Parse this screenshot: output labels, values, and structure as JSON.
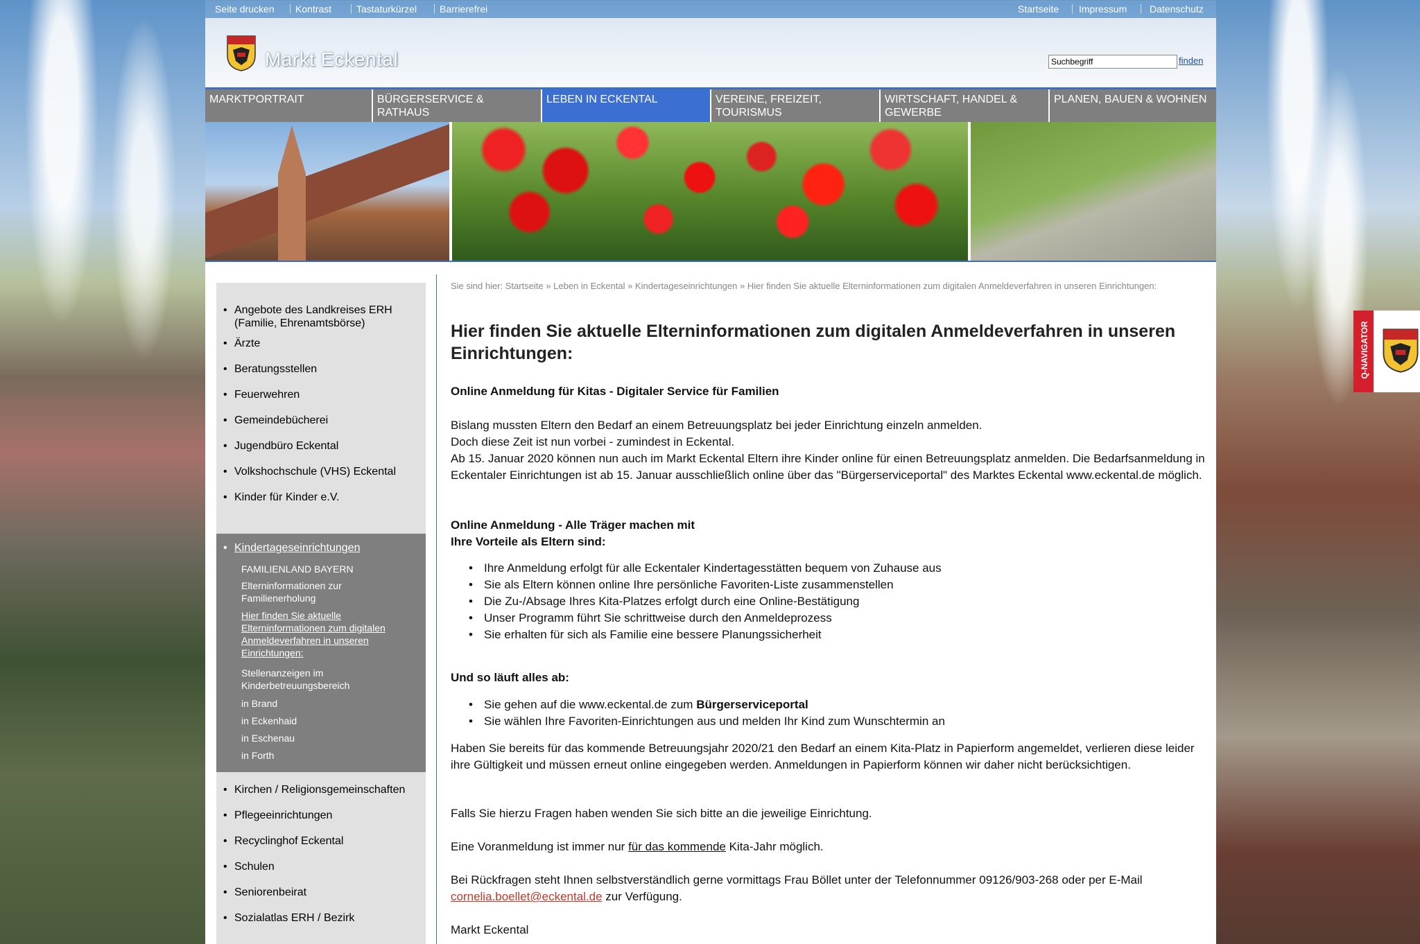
{
  "topbar": {
    "left": [
      "Seite drucken",
      "Kontrast",
      "Tastaturkürzel",
      "Barrierefrei"
    ],
    "right": [
      "Startseite",
      "Impressum",
      "Datenschutz"
    ]
  },
  "header": {
    "site_title": "Markt Eckental",
    "search_placeholder": "Suchbegriff",
    "search_button": "finden"
  },
  "nav": [
    "MARKTPORTRAIT",
    "BÜRGERSERVICE & RATHAUS",
    "LEBEN IN ECKENTAL",
    "VEREINE, FREIZEIT, TOURISMUS",
    "WIRTSCHAFT, HANDEL & GEWERBE",
    "PLANEN, BAUEN & WOHNEN"
  ],
  "sidebar": {
    "items_top": [
      "Angebote des Landkreises ERH (Familie, Ehrenamtsbörse)",
      "Ärzte",
      "Beratungsstellen",
      "Feuerwehren",
      "Gemeindebücherei",
      "Jugendbüro Eckental",
      "Volkshochschule (VHS) Eckental",
      "Kinder für Kinder e.V."
    ],
    "active": "Kindertageseinrichtungen",
    "sub": [
      "FAMILIENLAND BAYERN",
      "Elterninformationen zur Familienerholung",
      "Hier finden Sie aktuelle Elterninformationen zum digitalen Anmeldeverfahren in unseren Einrichtungen:",
      "Stellenanzeigen im Kinderbetreuungsbereich",
      "in Brand",
      "in Eckenhaid",
      "in Eschenau",
      "in Forth"
    ],
    "items_bottom": [
      "Kirchen / Religionsgemeinschaften",
      "Pflegeeinrichtungen",
      "Recyclinghof Eckental",
      "Schulen",
      "Seniorenbeirat",
      "Sozialatlas ERH / Bezirk"
    ]
  },
  "breadcrumb": "Sie sind hier: Startseite » Leben in Eckental » Kindertageseinrichtungen » Hier finden Sie aktuelle Elterninformationen zum digitalen Anmeldeverfahren in unseren Einrichtungen:",
  "main": {
    "title": "Hier finden Sie aktuelle Elterninformationen zum digitalen Anmeldeverfahren in unseren Einrichtungen:",
    "subtitle1": "Online Anmeldung für Kitas - Digitaler Service für Familien",
    "para1": [
      "Bislang mussten Eltern den Bedarf an einem Betreuungsplatz bei jeder Einrichtung einzeln anmelden.",
      "Doch diese Zeit ist nun vorbei - zumindest in Eckental.",
      "Ab 15. Januar 2020 können nun auch im Markt Eckental Eltern ihre Kinder online für einen Betreuungsplatz anmelden. Die Bedarfsanmeldung in Eckentaler Einrichtungen ist ab 15. Januar ausschließlich online über das \"Bürgerserviceportal\" des Marktes Eckental www.eckental.de möglich."
    ],
    "subtitle2a": "Online Anmeldung - Alle Träger machen mit",
    "subtitle2b": "Ihre Vorteile als Eltern sind:",
    "advantages": [
      "Ihre Anmeldung erfolgt für alle Eckentaler Kindertagesstätten bequem von Zuhause aus",
      "Sie als Eltern können online Ihre persönliche Favoriten-Liste zusammenstellen",
      "Die Zu-/Absage Ihres Kita-Platzes erfolgt durch eine Online-Bestätigung",
      "Unser Programm führt Sie schrittweise durch den Anmeldeprozess",
      "Sie erhalten für sich als Familie eine bessere Planungssicherheit"
    ],
    "subtitle3": "Und so läuft alles ab:",
    "step1_prefix": "Sie gehen auf die www.eckental.de zum ",
    "step1_bold": "Bürgerserviceportal",
    "step2": "Sie wählen Ihre Favoriten-Einrichtungen aus und melden Ihr Kind zum Wunschtermin an",
    "para2": "Haben Sie bereits für das kommende Betreuungsjahr 2020/21 den Bedarf an einem Kita-Platz in Papierform angemeldet, verlieren diese leider ihre Gültigkeit und müssen erneut online eingegeben werden. Anmeldungen in Papierform können wir daher nicht berücksichtigen.",
    "para3": "Falls Sie hierzu Fragen haben wenden Sie sich bitte an die jeweilige Einrichtung.",
    "para4_prefix": "Eine Voranmeldung ist immer nur ",
    "para4_link": "für das kommende",
    "para4_suffix": " Kita-Jahr möglich.",
    "para5_prefix": "Bei Rückfragen steht Ihnen selbstverständlich gerne vormittags Frau Böllet unter der Telefonnummer 09126/903-268 oder per E-Mail ",
    "para5_mail": "cornelia.boellet@eckental.de",
    "para5_suffix": " zur Verfügung.",
    "signature": "Markt Eckental"
  },
  "qnavigator": {
    "label": "Q-NAVIGATOR"
  },
  "colors": {
    "nav_active": "#3b6fd1",
    "nav": "#7f7f7f",
    "accent_red": "#d4202c",
    "link": "#1f4fa8"
  }
}
